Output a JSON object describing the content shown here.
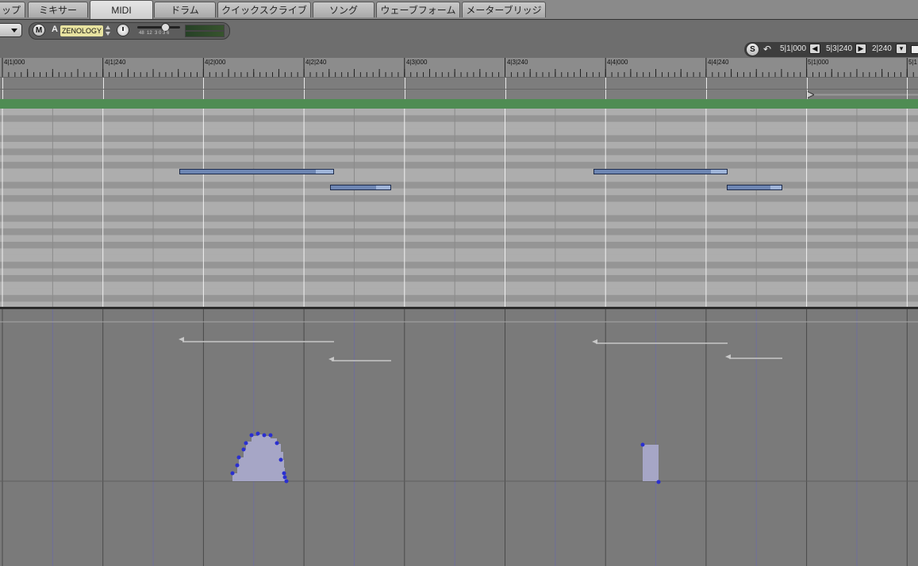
{
  "tabs": [
    {
      "label": "ップ",
      "active": false
    },
    {
      "label": "ミキサー",
      "active": false
    },
    {
      "label": "MIDI",
      "active": true
    },
    {
      "label": "ドラム",
      "active": false
    },
    {
      "label": "クイックスクライブ",
      "active": false
    },
    {
      "label": "ソング",
      "active": false
    },
    {
      "label": "ウェーブフォーム",
      "active": false
    },
    {
      "label": "メーターブリッジ",
      "active": false
    }
  ],
  "track": {
    "mute_label": "M",
    "auto_label": "A",
    "instrument_name": "ZENOLOGY",
    "meter_scale": "48  12  3 0 3 6"
  },
  "locator": {
    "solo_label": "S",
    "start": "5|1|000",
    "end": "5|3|240",
    "length": "2|240"
  },
  "ruler": {
    "labels": [
      "4|1|000",
      "4|1|240",
      "4|2|000",
      "4|2|240",
      "4|3|000",
      "4|3|240",
      "4|4|000",
      "4|4|240",
      "5|1|000",
      "5|1"
    ]
  },
  "colors": {
    "note_fill": "#6e86b3",
    "velocity_fill": "#9fb4d8",
    "conductor_track": "#4f8c53",
    "controller_point": "#2a2fd0",
    "instrument_label_bg": "#e8e3a0"
  },
  "icons": {
    "undo": "undo-icon",
    "prev": "arrow-left-icon",
    "next": "arrow-right-icon",
    "menu": "chevron-down-icon",
    "knob": "pan-knob-icon",
    "playhead": "playhead-triangle-icon"
  }
}
